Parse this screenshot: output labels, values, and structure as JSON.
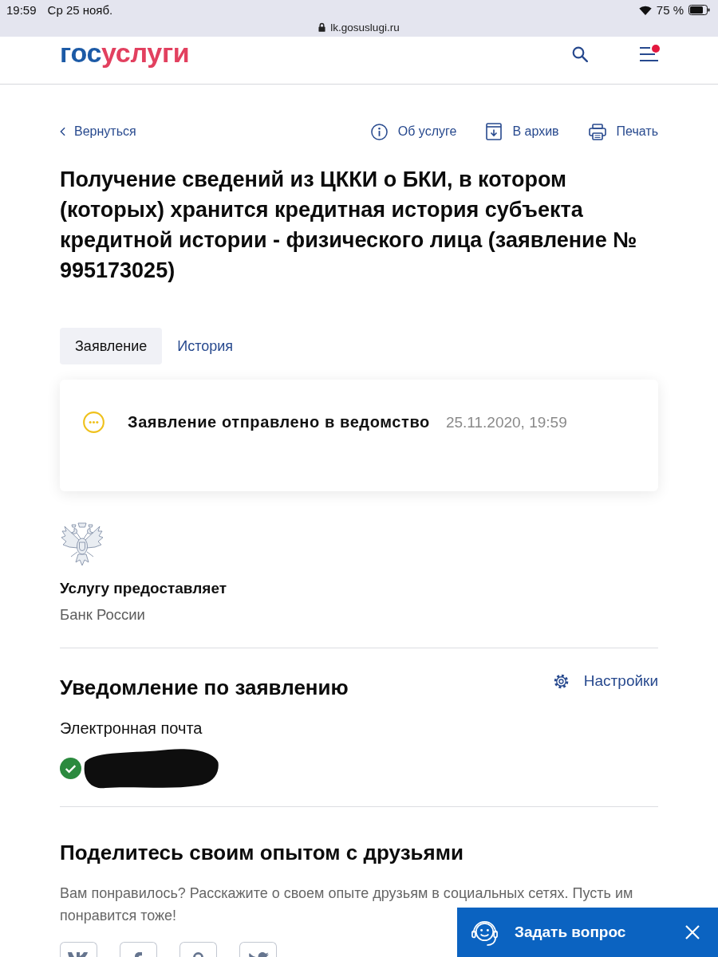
{
  "status_bar": {
    "time": "19:59",
    "date": "Ср 25 нояб.",
    "battery": "75 %",
    "url": "lk.gosuslugi.ru"
  },
  "header": {
    "logo": [
      {
        "text": "гос",
        "color": "#1c5aa6"
      },
      {
        "text": "услуги",
        "color": "#e2405f"
      }
    ],
    "menu_badge": true
  },
  "toolbar": {
    "back": "Вернуться",
    "actions": [
      {
        "kind": "info",
        "label": "Об услуге"
      },
      {
        "kind": "archive",
        "label": "В архив"
      },
      {
        "kind": "print",
        "label": "Печать"
      }
    ]
  },
  "title": "Получение сведений из ЦККИ о БКИ, в котором (которых) хранится кредитная история субъекта кредитной истории - физического лица (заявление № 995173025)",
  "tabs": [
    {
      "label": "Заявление",
      "selected": true
    },
    {
      "label": "История",
      "selected": false
    }
  ],
  "status_card": {
    "kind": "pending",
    "status": "Заявление отправлено в ведомство",
    "datetime": "25.11.2020, 19:59"
  },
  "provider": {
    "heading": "Услугу предоставляет",
    "name": "Банк России"
  },
  "notifications": {
    "heading": "Уведомление по заявлению",
    "settings": "Настройки",
    "channel": "Электронная почта",
    "confirmed": true
  },
  "share": {
    "heading": "Поделитесь своим опытом с друзьями",
    "text": "Вам понравилось? Расскажите о своем опыте друзьям в социальных сетях. Пусть им понравится тоже!",
    "buttons": [
      {
        "kind": "vk"
      },
      {
        "kind": "facebook"
      },
      {
        "kind": "odnoklassniki"
      },
      {
        "kind": "twitter"
      }
    ]
  },
  "chat": {
    "label": "Задать вопрос"
  }
}
